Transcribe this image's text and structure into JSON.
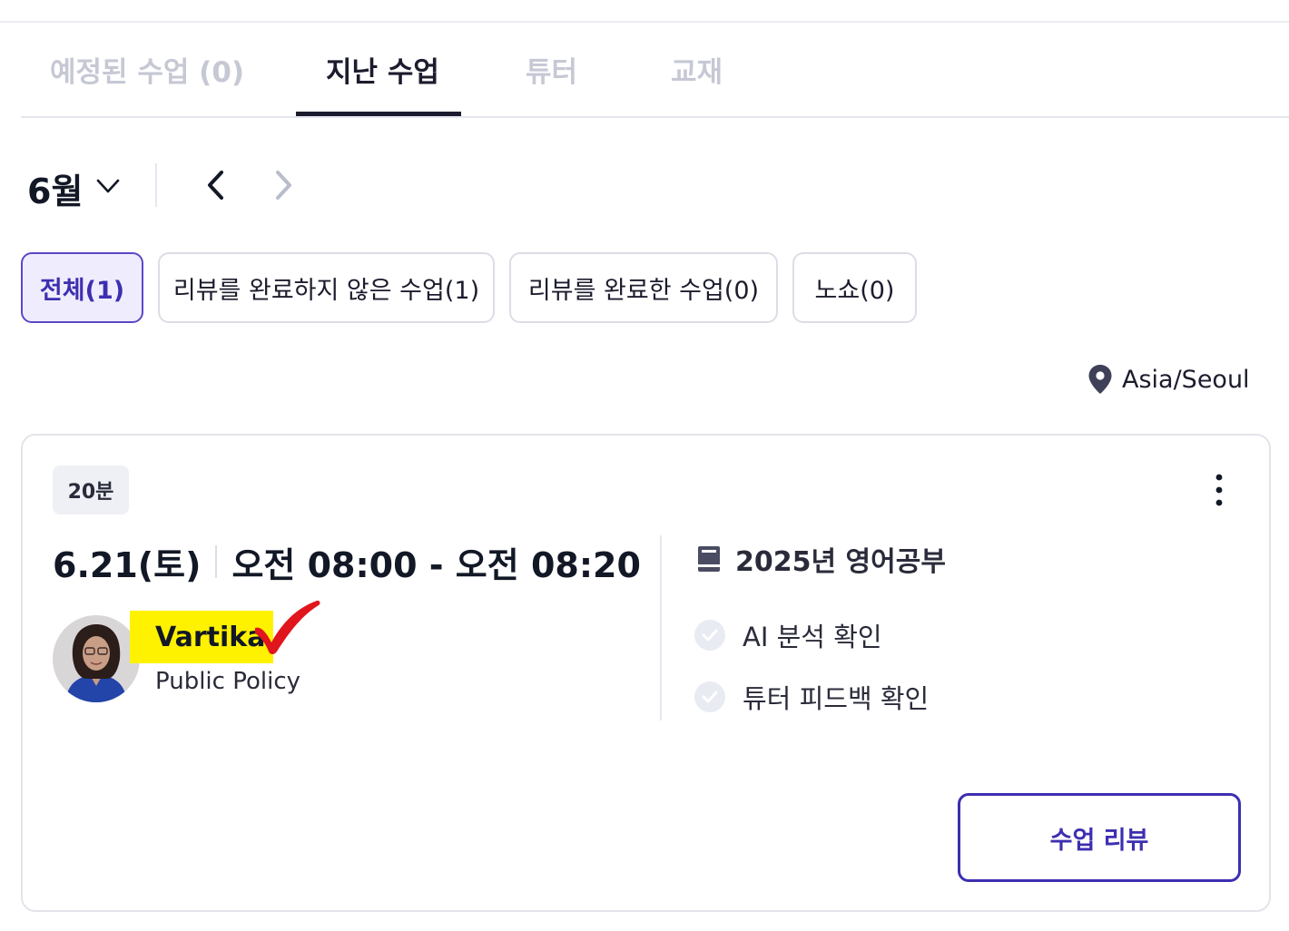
{
  "tabs": [
    {
      "label": "예정된 수업 (0)"
    },
    {
      "label": "지난 수업"
    },
    {
      "label": "튜터"
    },
    {
      "label": "교재"
    }
  ],
  "month": {
    "label": "6월"
  },
  "filters": [
    {
      "label": "전체(1)"
    },
    {
      "label": "리뷰를 완료하지 않은 수업(1)"
    },
    {
      "label": "리뷰를 완료한 수업(0)"
    },
    {
      "label": "노쇼(0)"
    }
  ],
  "timezone": {
    "label": "Asia/Seoul",
    "icon": "map-pin-icon"
  },
  "lesson": {
    "duration": "20분",
    "date": "6.21(토)",
    "time": "오전 08:00 - 오전 08:20",
    "tutor": {
      "name": "Vartika",
      "subtitle": "Public Policy"
    },
    "course": {
      "title": "2025년 영어공부",
      "icon": "book-icon"
    },
    "checks": [
      {
        "label": "AI 분석 확인"
      },
      {
        "label": "튜터 피드백 확인"
      }
    ],
    "review_button": "수업 리뷰"
  },
  "colors": {
    "accent": "#3d2fb0",
    "highlight": "#fff200",
    "annotation_check": "#e0161c"
  }
}
